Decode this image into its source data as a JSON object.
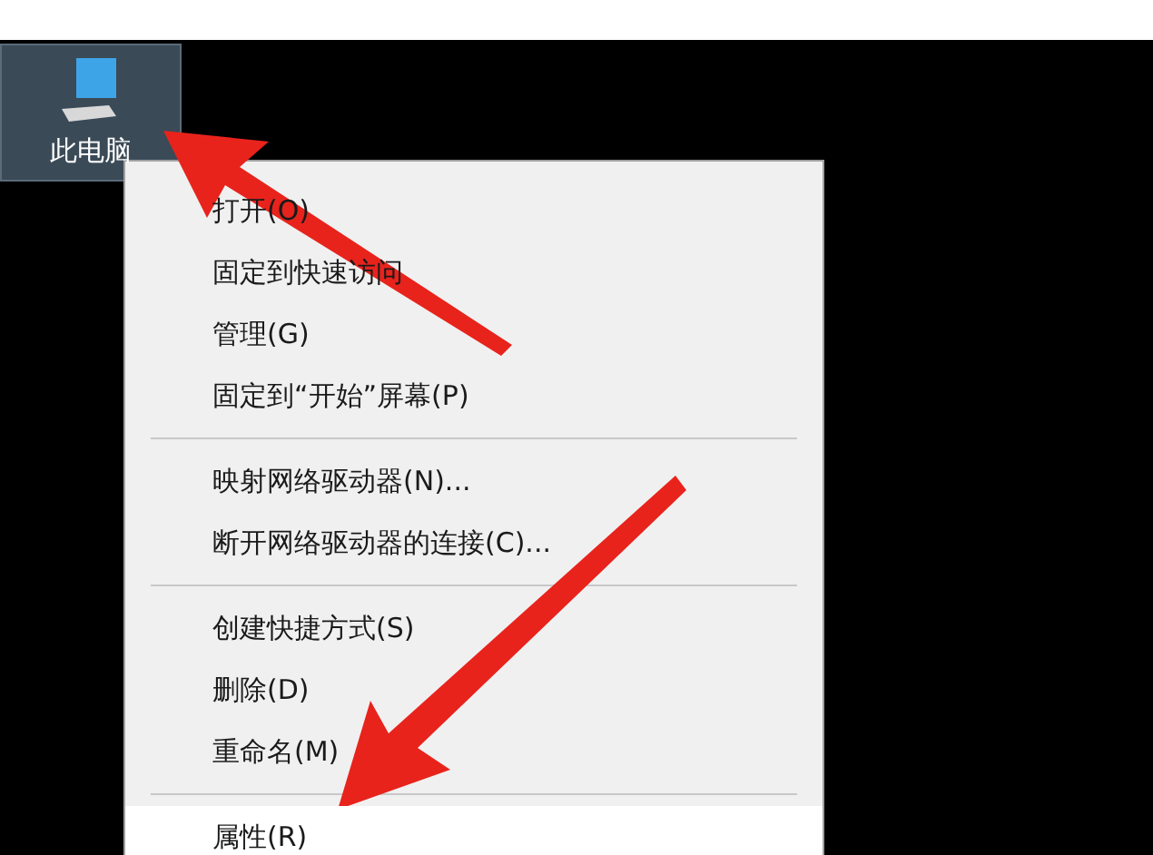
{
  "desktop_icon": {
    "label": "此电脑",
    "selected": true
  },
  "context_menu": {
    "groups": [
      [
        {
          "label": "打开(O)",
          "selected": false
        },
        {
          "label": "固定到快速访问",
          "selected": false
        },
        {
          "label": "管理(G)",
          "selected": false
        },
        {
          "label": "固定到“开始”屏幕(P)",
          "selected": false
        }
      ],
      [
        {
          "label": "映射网络驱动器(N)...",
          "selected": false
        },
        {
          "label": "断开网络驱动器的连接(C)...",
          "selected": false
        }
      ],
      [
        {
          "label": "创建快捷方式(S)",
          "selected": false
        },
        {
          "label": "删除(D)",
          "selected": false
        },
        {
          "label": "重命名(M)",
          "selected": false
        }
      ],
      [
        {
          "label": "属性(R)",
          "selected": true
        }
      ]
    ]
  }
}
